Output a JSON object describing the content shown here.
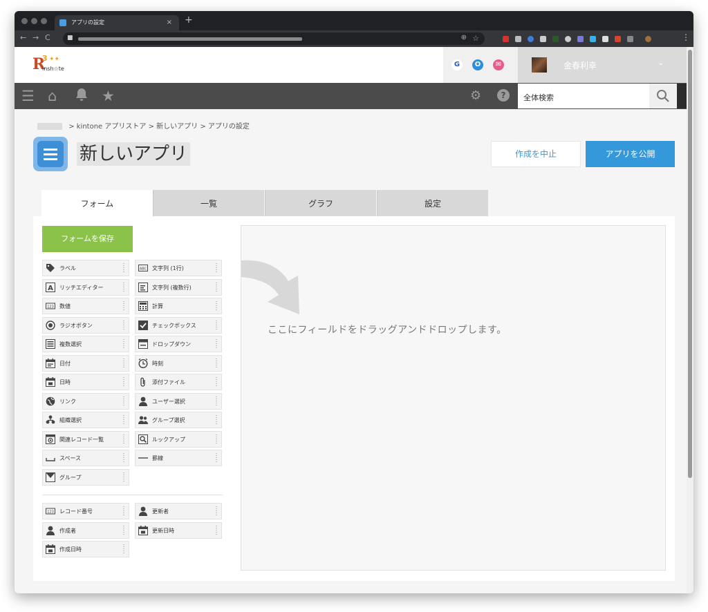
{
  "browser": {
    "tab_title": "アプリの設定",
    "tab_close": "×",
    "new_tab": "+",
    "nav_back": "←",
    "nav_forward": "→",
    "nav_reload": "C"
  },
  "header": {
    "logo_letter": "R",
    "logo_sup": "3",
    "logo_word": "insh☆te",
    "user_name": "金春利幸",
    "quick_links": [
      "G",
      "O",
      "✉"
    ]
  },
  "global_nav": {
    "search_placeholder": "全体検索"
  },
  "breadcrumb": {
    "separator": ">",
    "items": [
      "kintone アプリストア",
      "新しいアプリ",
      "アプリの設定"
    ]
  },
  "app": {
    "title": "新しいアプリ",
    "cancel_label": "作成を中止",
    "publish_label": "アプリを公開"
  },
  "tabs": [
    "フォーム",
    "一覧",
    "グラフ",
    "設定"
  ],
  "form": {
    "save_label": "フォームを保存",
    "drop_text": "ここにフィールドをドラッグアンドドロップします。",
    "fields": [
      {
        "label": "ラベル",
        "icon": "label-icon"
      },
      {
        "label": "文字列 (1行)",
        "icon": "text-single-icon"
      },
      {
        "label": "リッチエディター",
        "icon": "rich-editor-icon"
      },
      {
        "label": "文字列 (複数行)",
        "icon": "text-multi-icon"
      },
      {
        "label": "数値",
        "icon": "number-icon"
      },
      {
        "label": "計算",
        "icon": "calc-icon"
      },
      {
        "label": "ラジオボタン",
        "icon": "radio-icon"
      },
      {
        "label": "チェックボックス",
        "icon": "checkbox-icon"
      },
      {
        "label": "複数選択",
        "icon": "multi-select-icon"
      },
      {
        "label": "ドロップダウン",
        "icon": "dropdown-icon"
      },
      {
        "label": "日付",
        "icon": "date-icon"
      },
      {
        "label": "時刻",
        "icon": "time-icon"
      },
      {
        "label": "日時",
        "icon": "datetime-icon"
      },
      {
        "label": "添付ファイル",
        "icon": "attachment-icon"
      },
      {
        "label": "リンク",
        "icon": "link-icon"
      },
      {
        "label": "ユーザー選択",
        "icon": "user-select-icon"
      },
      {
        "label": "組織選択",
        "icon": "org-select-icon"
      },
      {
        "label": "グループ選択",
        "icon": "group-select-icon"
      },
      {
        "label": "関連レコード一覧",
        "icon": "related-records-icon"
      },
      {
        "label": "ルックアップ",
        "icon": "lookup-icon"
      },
      {
        "label": "スペース",
        "icon": "space-icon"
      },
      {
        "label": "罫線",
        "icon": "border-icon"
      },
      {
        "label": "グループ",
        "icon": "group-icon"
      }
    ],
    "system_fields": [
      {
        "label": "レコード番号",
        "icon": "record-number-icon"
      },
      {
        "label": "作成者",
        "icon": "creator-icon"
      },
      {
        "label": "作成日時",
        "icon": "created-datetime-icon"
      },
      {
        "label": "更新者",
        "icon": "updater-icon"
      },
      {
        "label": "更新日時",
        "icon": "updated-datetime-icon"
      }
    ]
  },
  "colors": {
    "accent": "#3498db",
    "save_green": "#8bc34a",
    "nav_bg": "#4b4b4b"
  }
}
